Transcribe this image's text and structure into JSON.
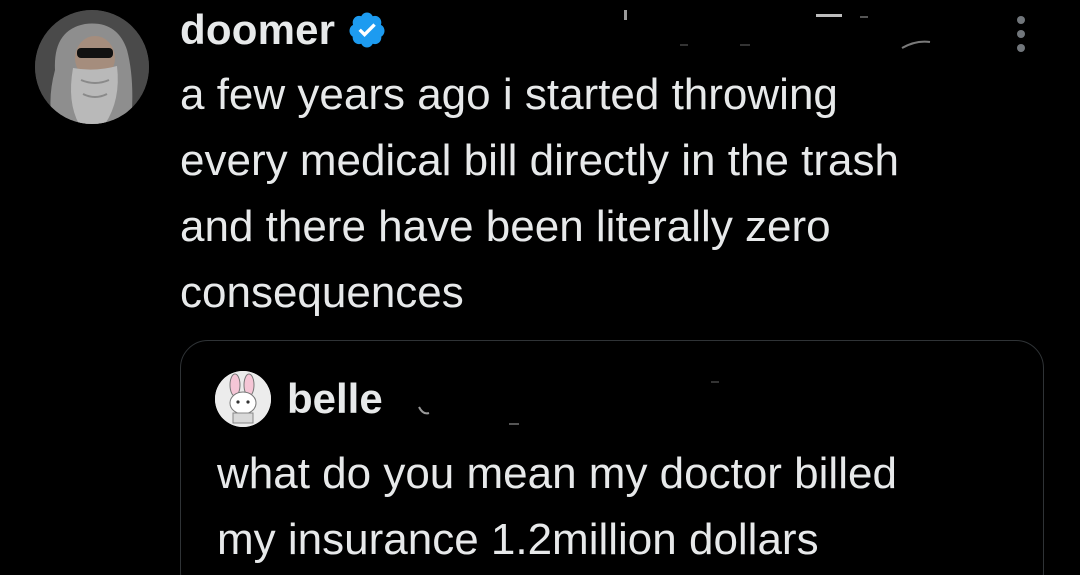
{
  "tweet": {
    "author": {
      "display_name": "doomer",
      "verified": true,
      "avatar_icon": "bearded-man-sunglasses-avatar"
    },
    "text": "a few years ago i started throwing\nevery medical bill directly in the trash\nand there have been literally zero\nconsequences",
    "more_icon": "more-vertical-icon"
  },
  "quote": {
    "author": {
      "display_name": "belle",
      "avatar_icon": "cartoon-bunny-avatar"
    },
    "text": "what do you mean my doctor billed\nmy insurance 1.2million dollars"
  },
  "colors": {
    "background": "#000000",
    "text": "#e7e9ea",
    "verified_blue": "#1d9bf0",
    "border": "#2f3336"
  }
}
